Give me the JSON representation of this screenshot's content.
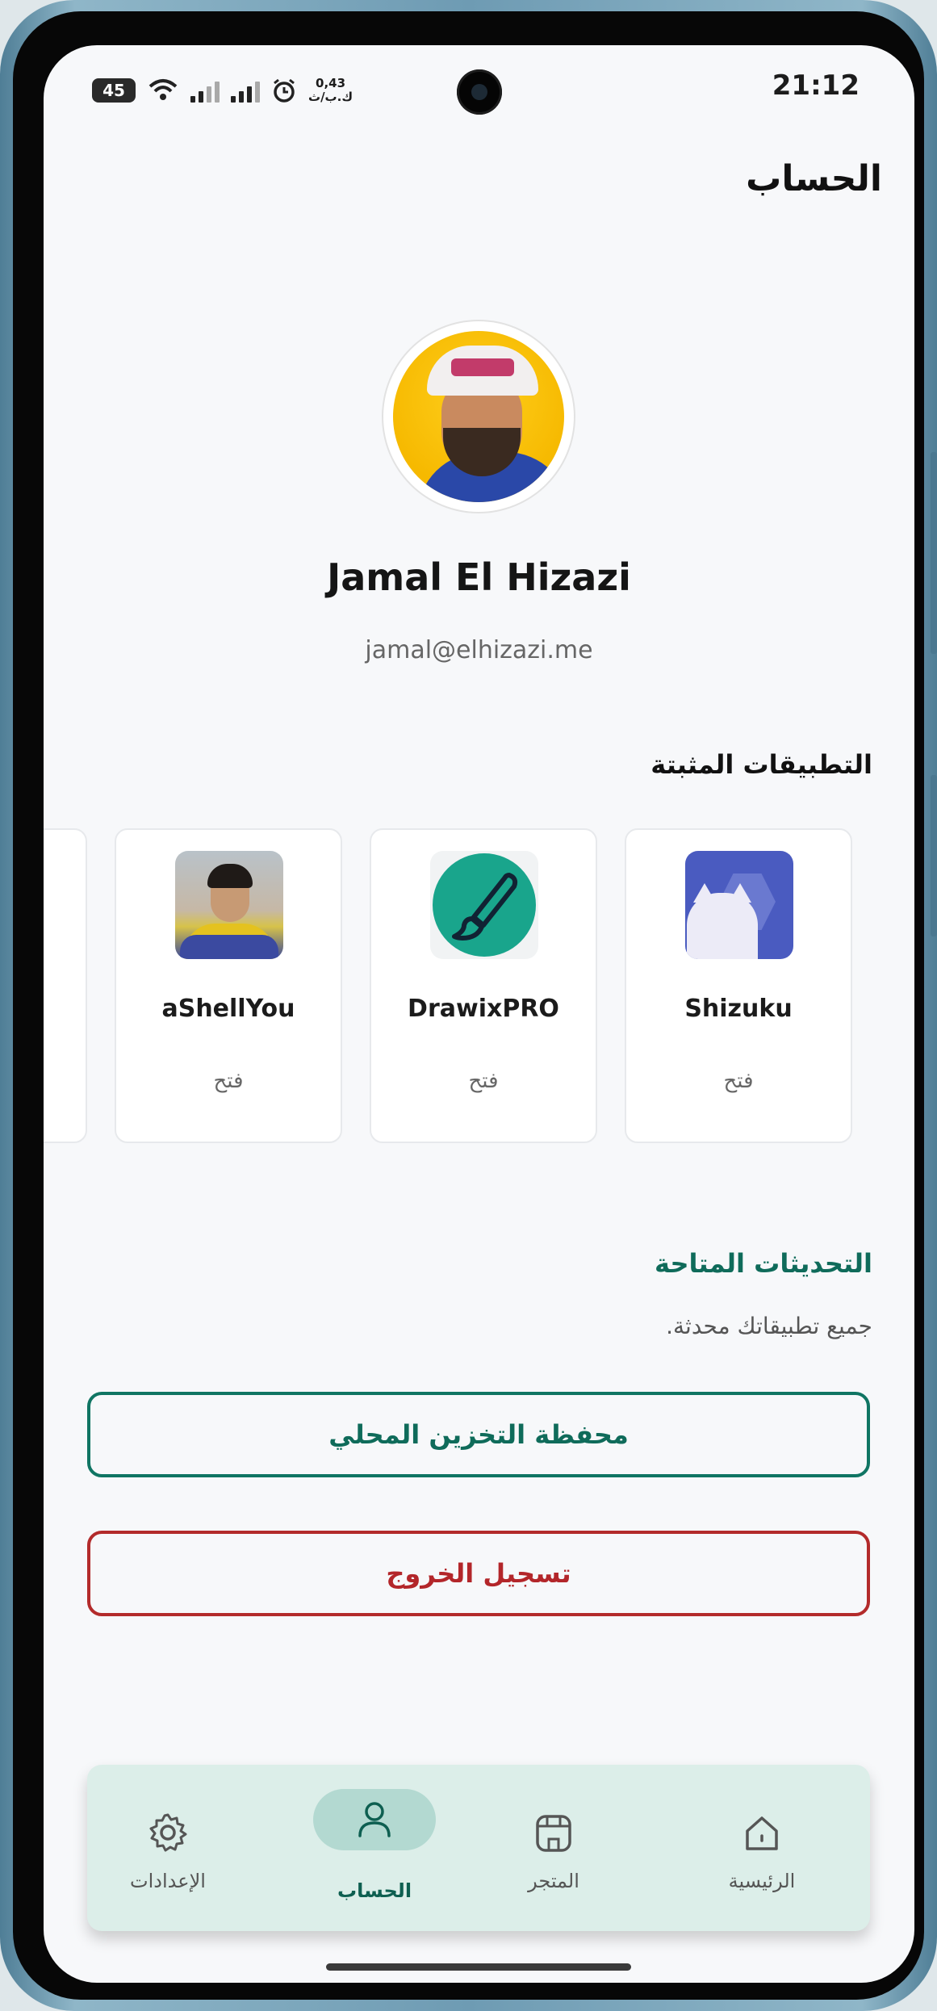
{
  "status_bar": {
    "time": "21:12",
    "battery": "45",
    "net_speed_value": "0,43",
    "net_speed_unit": "ك.ب/ث"
  },
  "header": {
    "title": "الحساب"
  },
  "profile": {
    "name": "Jamal El Hizazi",
    "email": "jamal@elhizazi.me"
  },
  "installed_apps": {
    "title": "التطبيقات المثبتة",
    "title_color": "#111111",
    "items": [
      {
        "name": "Shizuku",
        "action": "فتح",
        "icon": "shizuku-icon"
      },
      {
        "name": "DrawixPRO",
        "action": "فتح",
        "icon": "brush-icon"
      },
      {
        "name": "aShellYou",
        "action": "فتح",
        "icon": "ashellyou-icon"
      }
    ]
  },
  "updates": {
    "title": "التحديثات المتاحة",
    "title_color": "#0f6b5a",
    "message": "جميع تطبيقاتك محدثة."
  },
  "buttons": {
    "local_storage": "محفظة التخزين المحلي",
    "logout": "تسجيل الخروج"
  },
  "bottom_nav": {
    "items": [
      {
        "label": "الرئيسية",
        "icon": "home-icon"
      },
      {
        "label": "المتجر",
        "icon": "store-icon"
      },
      {
        "label": "الحساب",
        "icon": "person-icon",
        "active": true
      },
      {
        "label": "الإعدادات",
        "icon": "gear-icon"
      }
    ]
  },
  "colors": {
    "accent": "#107563",
    "danger": "#b32b2b",
    "background": "#f7f8fa"
  }
}
